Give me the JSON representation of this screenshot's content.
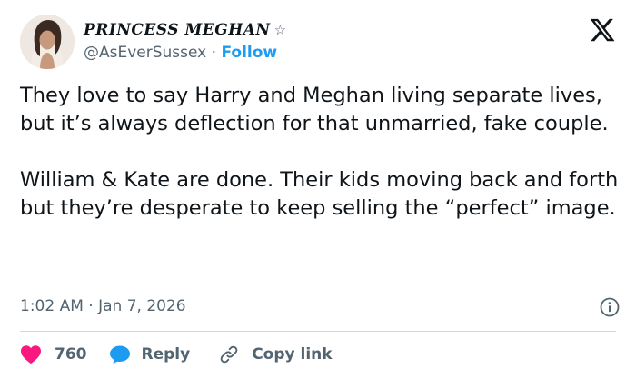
{
  "author": {
    "display_name": "PRINCESS MEGHAN",
    "badge_glyph": "☆",
    "handle": "@AsEverSussex",
    "separator": "·",
    "follow_label": "Follow"
  },
  "tweet": {
    "paragraphs": [
      "They love to say Harry and Meghan living separate lives, but it’s always deflection for that unmarried, fake couple.",
      "William & Kate are done. Their kids moving back and forth but they’re desperate to keep selling the “perfect” image."
    ],
    "time": "1:02 AM",
    "separator": "·",
    "date": "Jan 7, 2026"
  },
  "actions": {
    "like_count": "760",
    "reply_label": "Reply",
    "copy_link_label": "Copy link"
  },
  "icons": {
    "logo": "x-logo-icon",
    "info": "info-icon",
    "like": "heart-icon",
    "reply": "speech-bubble-icon",
    "copy": "link-icon"
  },
  "colors": {
    "accent": "#1d9bf0",
    "like": "#f91880",
    "text": "#0f1419",
    "secondary": "#536471",
    "divider": "#cfd9de"
  }
}
